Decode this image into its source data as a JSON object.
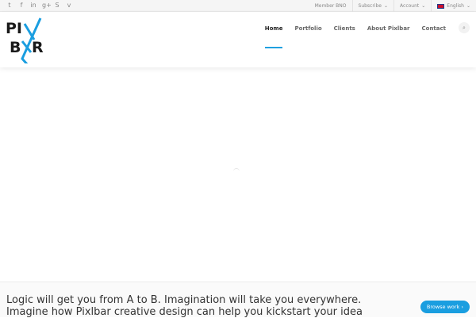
{
  "topbar": {
    "social": [
      {
        "icon": "twitter-icon",
        "glyph": "t"
      },
      {
        "icon": "facebook-icon",
        "glyph": "f"
      },
      {
        "icon": "linkedin-icon",
        "glyph": "in"
      },
      {
        "icon": "google-plus-icon",
        "glyph": "g+"
      },
      {
        "icon": "skype-icon",
        "glyph": "S"
      },
      {
        "icon": "vimeo-icon",
        "glyph": "v"
      }
    ],
    "links": {
      "member": "Member BNO",
      "subscribe": "Subscribe",
      "account": "Account",
      "language": "English"
    }
  },
  "header": {
    "logo_text": "PIXBXR",
    "nav": [
      "Home",
      "Portfolio",
      "Clients",
      "About Pixlbar",
      "Contact"
    ]
  },
  "cta": {
    "text": "Logic will get you from A to B. Imagination will take you everywhere. Imagine how Pixlbar creative design can help you kickstart your idea",
    "button": "Browse work ›"
  },
  "colors": {
    "accent": "#1a9ee0"
  }
}
